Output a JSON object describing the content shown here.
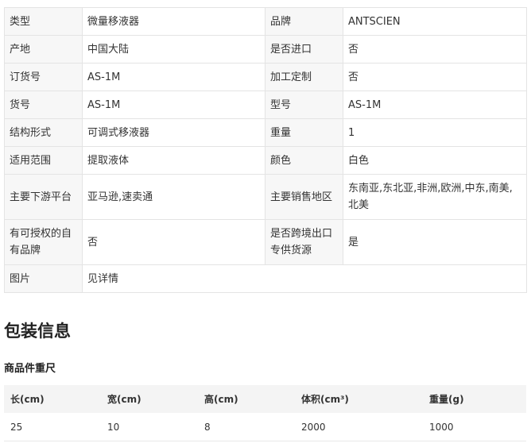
{
  "specs": [
    [
      {
        "k": "类型",
        "v": "微量移液器"
      },
      {
        "k": "品牌",
        "v": "ANTSCIEN"
      }
    ],
    [
      {
        "k": "产地",
        "v": "中国大陆"
      },
      {
        "k": "是否进口",
        "v": "否"
      }
    ],
    [
      {
        "k": "订货号",
        "v": "AS-1M"
      },
      {
        "k": "加工定制",
        "v": "否"
      }
    ],
    [
      {
        "k": "货号",
        "v": "AS-1M"
      },
      {
        "k": "型号",
        "v": "AS-1M"
      }
    ],
    [
      {
        "k": "结构形式",
        "v": "可调式移液器"
      },
      {
        "k": "重量",
        "v": "1"
      }
    ],
    [
      {
        "k": "适用范围",
        "v": "提取液体"
      },
      {
        "k": "颜色",
        "v": "白色"
      }
    ],
    [
      {
        "k": "主要下游平台",
        "v": "亚马逊,速卖通"
      },
      {
        "k": "主要销售地区",
        "v": "东南亚,东北亚,非洲,欧洲,中东,南美,北美"
      }
    ],
    [
      {
        "k": "有可授权的自有品牌",
        "v": "否"
      },
      {
        "k": "是否跨境出口专供货源",
        "v": "是"
      }
    ]
  ],
  "last_row": {
    "k": "图片",
    "v": "见详情"
  },
  "packaging": {
    "title": "包装信息",
    "subtitle": "商品件重尺",
    "headers": [
      "长(cm)",
      "宽(cm)",
      "高(cm)",
      "体积(cm³)",
      "重量(g)"
    ],
    "values": [
      "25",
      "10",
      "8",
      "2000",
      "1000"
    ]
  }
}
